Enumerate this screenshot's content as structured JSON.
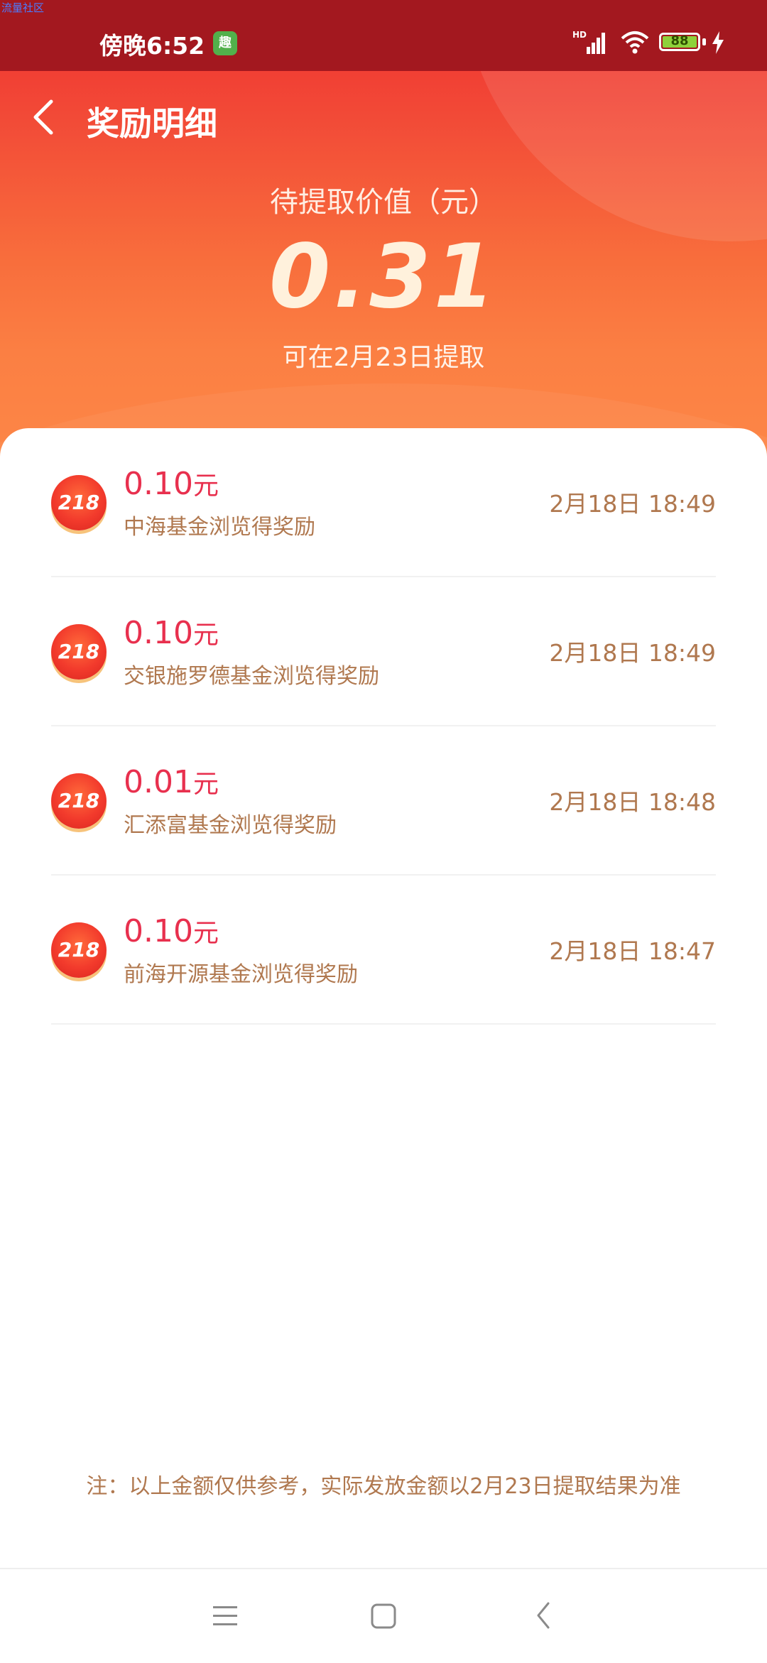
{
  "watermark": "流量社区",
  "status_bar": {
    "time": "傍晚6:52",
    "app_icon_label": "趣",
    "battery_level": "88",
    "signal_label": "HD",
    "icons": [
      "signal-icon",
      "wifi-icon",
      "battery-icon",
      "charging-icon"
    ]
  },
  "header": {
    "title": "奖励明细",
    "back_icon": "chevron-left-icon"
  },
  "summary": {
    "label": "待提取价值（元）",
    "amount": "0.31",
    "withdraw_date": "可在2月23日提取"
  },
  "rewards": [
    {
      "badge": "218",
      "amount": "0.10",
      "unit": "元",
      "description": "中海基金浏览得奖励",
      "time": "2月18日 18:49"
    },
    {
      "badge": "218",
      "amount": "0.10",
      "unit": "元",
      "description": "交银施罗德基金浏览得奖励",
      "time": "2月18日 18:49"
    },
    {
      "badge": "218",
      "amount": "0.01",
      "unit": "元",
      "description": "汇添富基金浏览得奖励",
      "time": "2月18日 18:48"
    },
    {
      "badge": "218",
      "amount": "0.10",
      "unit": "元",
      "description": "前海开源基金浏览得奖励",
      "time": "2月18日 18:47"
    }
  ],
  "footnote": "注：以上金额仅供参考，实际发放金额以2月23日提取结果为准",
  "nav_bar": {
    "icons": [
      "menu-icon",
      "home-square-icon",
      "back-triangle-icon"
    ]
  },
  "colors": {
    "accent_red": "#e8304e",
    "text_brown": "#b0784f",
    "header_red": "#ef2f2f",
    "header_orange": "#fd8747"
  }
}
